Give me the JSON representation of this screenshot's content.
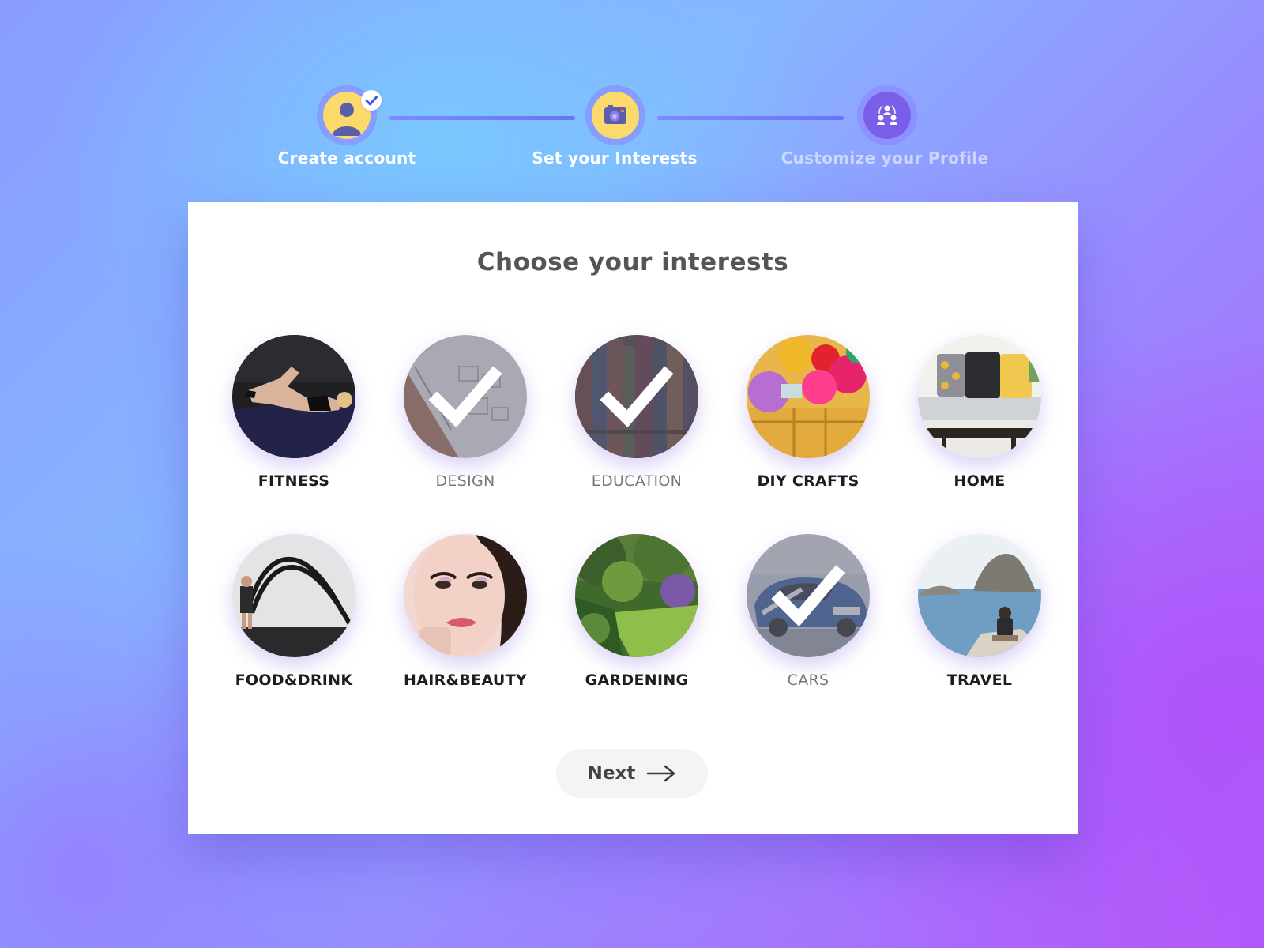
{
  "stepper": {
    "steps": [
      {
        "label": "Create account",
        "icon": "user-icon",
        "state": "completed"
      },
      {
        "label": "Set your Interests",
        "icon": "camera-icon",
        "state": "current"
      },
      {
        "label": "Customize your Profile",
        "icon": "people-icon",
        "state": "upcoming"
      }
    ]
  },
  "card": {
    "title": "Choose your interests",
    "interests": [
      {
        "label": "FITNESS",
        "selected": false,
        "image": "woman-doing-crunches"
      },
      {
        "label": "DESIGN",
        "selected": true,
        "image": "sketchbook-wireframes"
      },
      {
        "label": "EDUCATION",
        "selected": true,
        "image": "bookshelf"
      },
      {
        "label": "DIY CRAFTS",
        "selected": false,
        "image": "yarn-balls-basket"
      },
      {
        "label": "HOME",
        "selected": false,
        "image": "sofa-with-pillows"
      },
      {
        "label": "FOOD&DRINK",
        "selected": false,
        "image": "battle-ropes-workout"
      },
      {
        "label": "HAIR&BEAUTY",
        "selected": false,
        "image": "woman-applying-makeup"
      },
      {
        "label": "GARDENING",
        "selected": false,
        "image": "garden-lawn"
      },
      {
        "label": "CARS",
        "selected": true,
        "image": "sports-car"
      },
      {
        "label": "TRAVEL",
        "selected": false,
        "image": "man-by-sea-rocks"
      }
    ],
    "next_label": "Next"
  },
  "colors": {
    "step_active_fill": "#fcd96b",
    "step_upcoming_fill": "#7a5de8",
    "selected_check": "#ffffff",
    "badge_check": "#4a55e6"
  }
}
